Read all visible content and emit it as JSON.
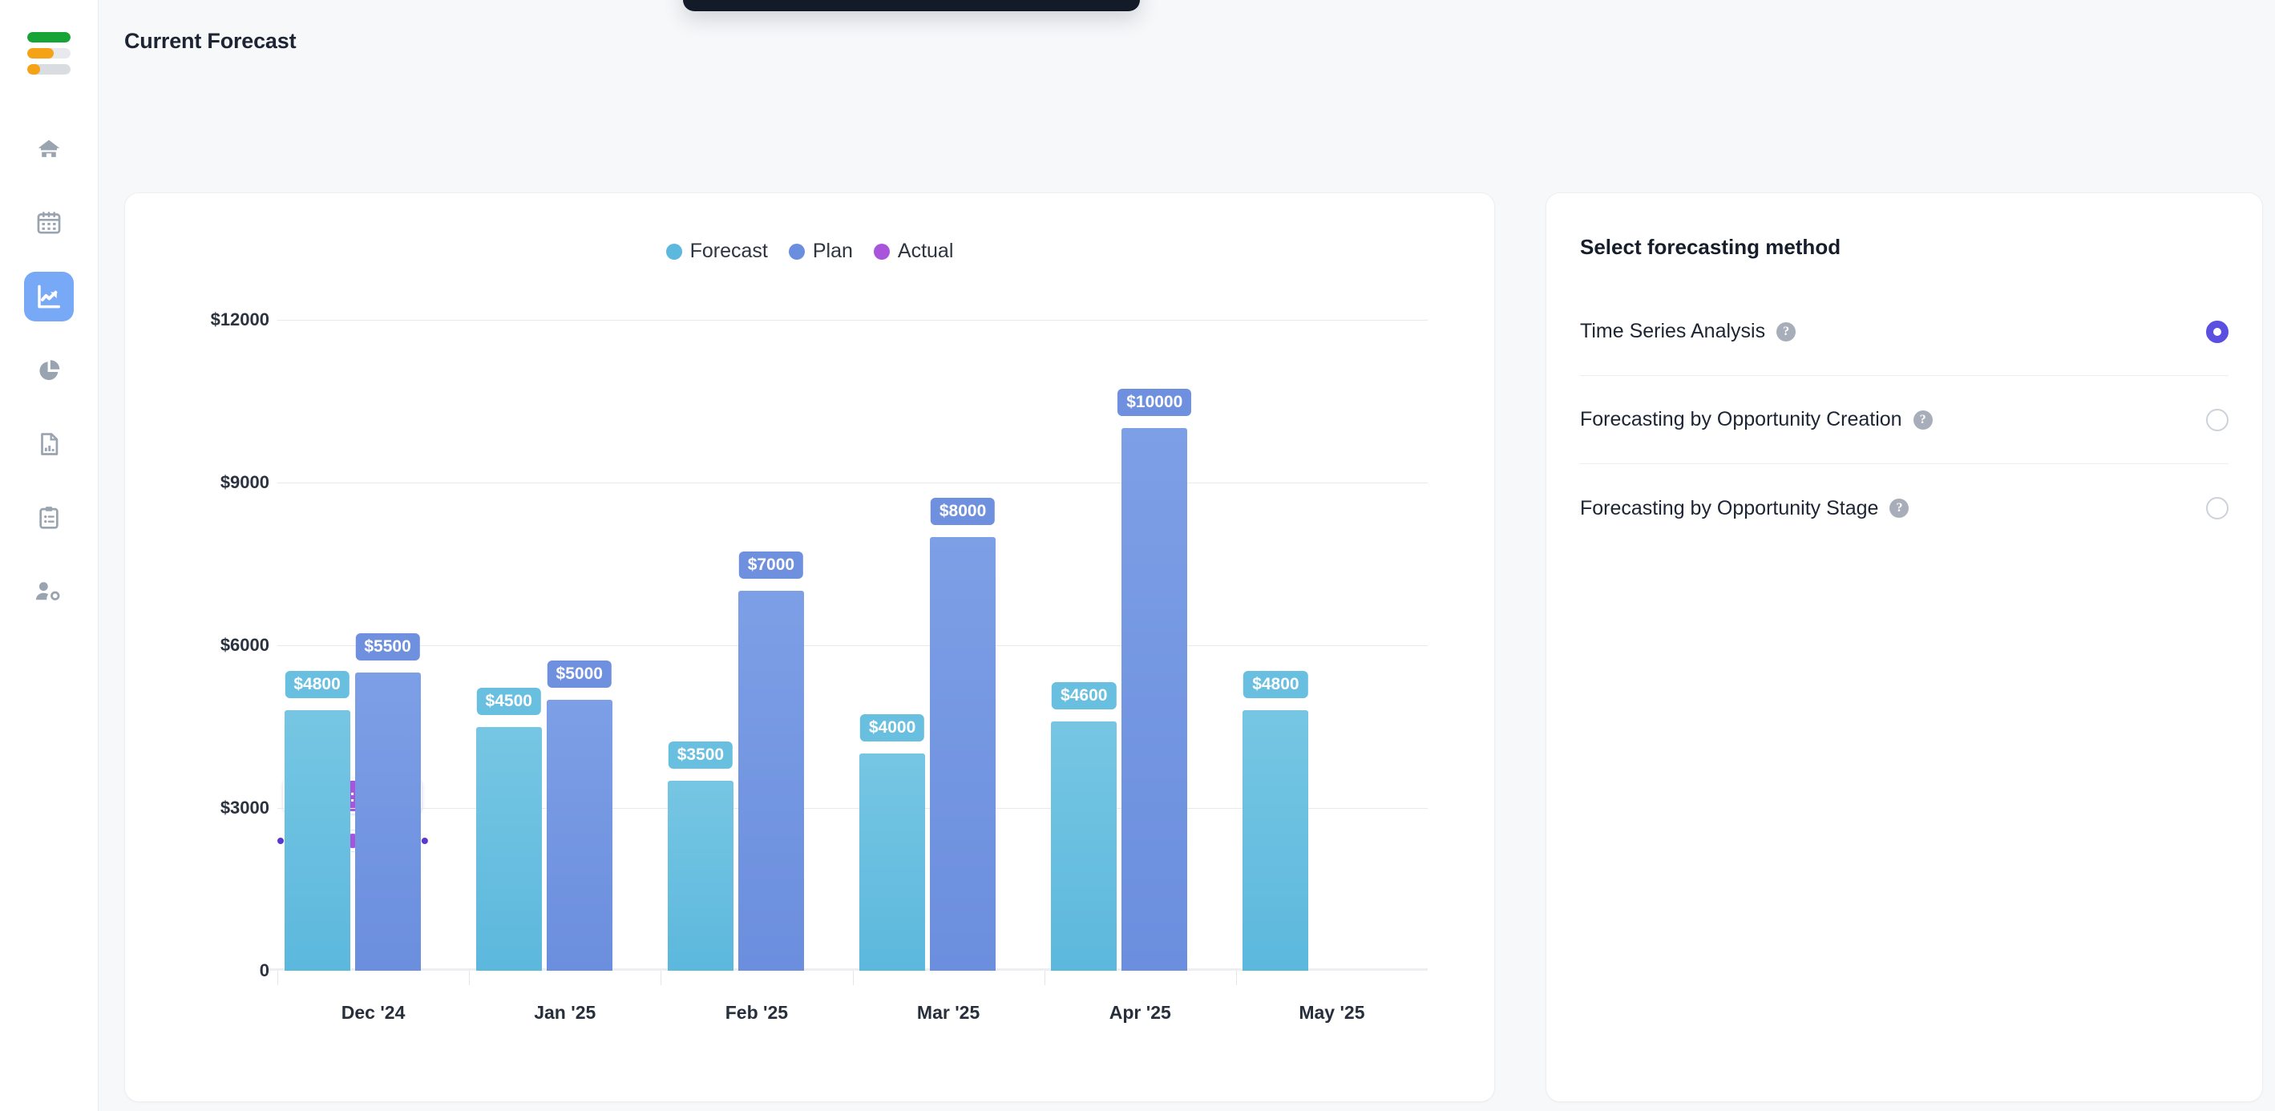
{
  "app": {
    "logo_name": "stacked-bars-logo",
    "logo_bars": [
      {
        "name": "logo-bar-green",
        "fill_pct": 100,
        "color": "#17a436",
        "track": "#ffffff"
      },
      {
        "name": "logo-bar-orange-1",
        "fill_pct": 62,
        "color": "#f5a216",
        "track": "#e7e9ec"
      },
      {
        "name": "logo-bar-orange-2",
        "fill_pct": 30,
        "color": "#f5a216",
        "track": "#d9dde2"
      }
    ]
  },
  "sidebar": {
    "items": [
      {
        "icon": "home-icon",
        "label": "Home",
        "active": false
      },
      {
        "icon": "calendar-icon",
        "label": "Calendar",
        "active": false
      },
      {
        "icon": "trend-chart-icon",
        "label": "Forecast",
        "active": true
      },
      {
        "icon": "pie-chart-icon",
        "label": "Analytics",
        "active": false
      },
      {
        "icon": "report-document-icon",
        "label": "Reports",
        "active": false
      },
      {
        "icon": "clipboard-icon",
        "label": "Tasks",
        "active": false
      },
      {
        "icon": "users-settings-icon",
        "label": "Team Settings",
        "active": false
      }
    ],
    "active_accent": "#78a9f7"
  },
  "header": {
    "title": "Current Forecast"
  },
  "toast": {
    "visible": true,
    "color": "#131b29"
  },
  "chart_data": {
    "type": "bar",
    "title": "",
    "xlabel": "",
    "ylabel": "",
    "categories": [
      "Dec '24",
      "Jan '25",
      "Feb '25",
      "Mar '25",
      "Apr '25",
      "May '25"
    ],
    "ylim": [
      0,
      12000
    ],
    "yticks": [
      0,
      3000,
      6000,
      9000,
      12000
    ],
    "ytick_labels": [
      "0",
      "$3000",
      "$6000",
      "$9000",
      "$12000"
    ],
    "grid": true,
    "legend_position": "top-center",
    "series": [
      {
        "name": "Forecast",
        "color": "#5cb8dd",
        "values": [
          4800,
          4500,
          3500,
          4000,
          4600,
          4800
        ],
        "labels": [
          "$4800",
          "$4500",
          "$3500",
          "$4000",
          "$4600",
          "$4800"
        ]
      },
      {
        "name": "Plan",
        "color": "#6b8ede",
        "values": [
          5500,
          5000,
          7000,
          8000,
          10000,
          null
        ],
        "labels": [
          "$5500",
          "$5000",
          "$7000",
          "$8000",
          "$10000",
          null
        ]
      },
      {
        "name": "Actual",
        "color": "#a855dc",
        "type": "line",
        "values": [
          2400,
          null,
          null,
          null,
          null,
          null
        ],
        "labels": [
          "Actual: $2400",
          null,
          null,
          null,
          null,
          null
        ]
      }
    ],
    "tooltip": {
      "text": "Actual: $2400",
      "series": "Actual",
      "category": "Dec '24",
      "value": 2400
    }
  },
  "method_panel": {
    "title": "Select forecasting method",
    "selected_color": "#5b4ee0",
    "options": [
      {
        "label": "Time Series Analysis",
        "help": "?",
        "selected": true
      },
      {
        "label": "Forecasting by Opportunity Creation",
        "help": "?",
        "selected": false
      },
      {
        "label": "Forecasting by Opportunity Stage",
        "help": "?",
        "selected": false
      }
    ]
  }
}
